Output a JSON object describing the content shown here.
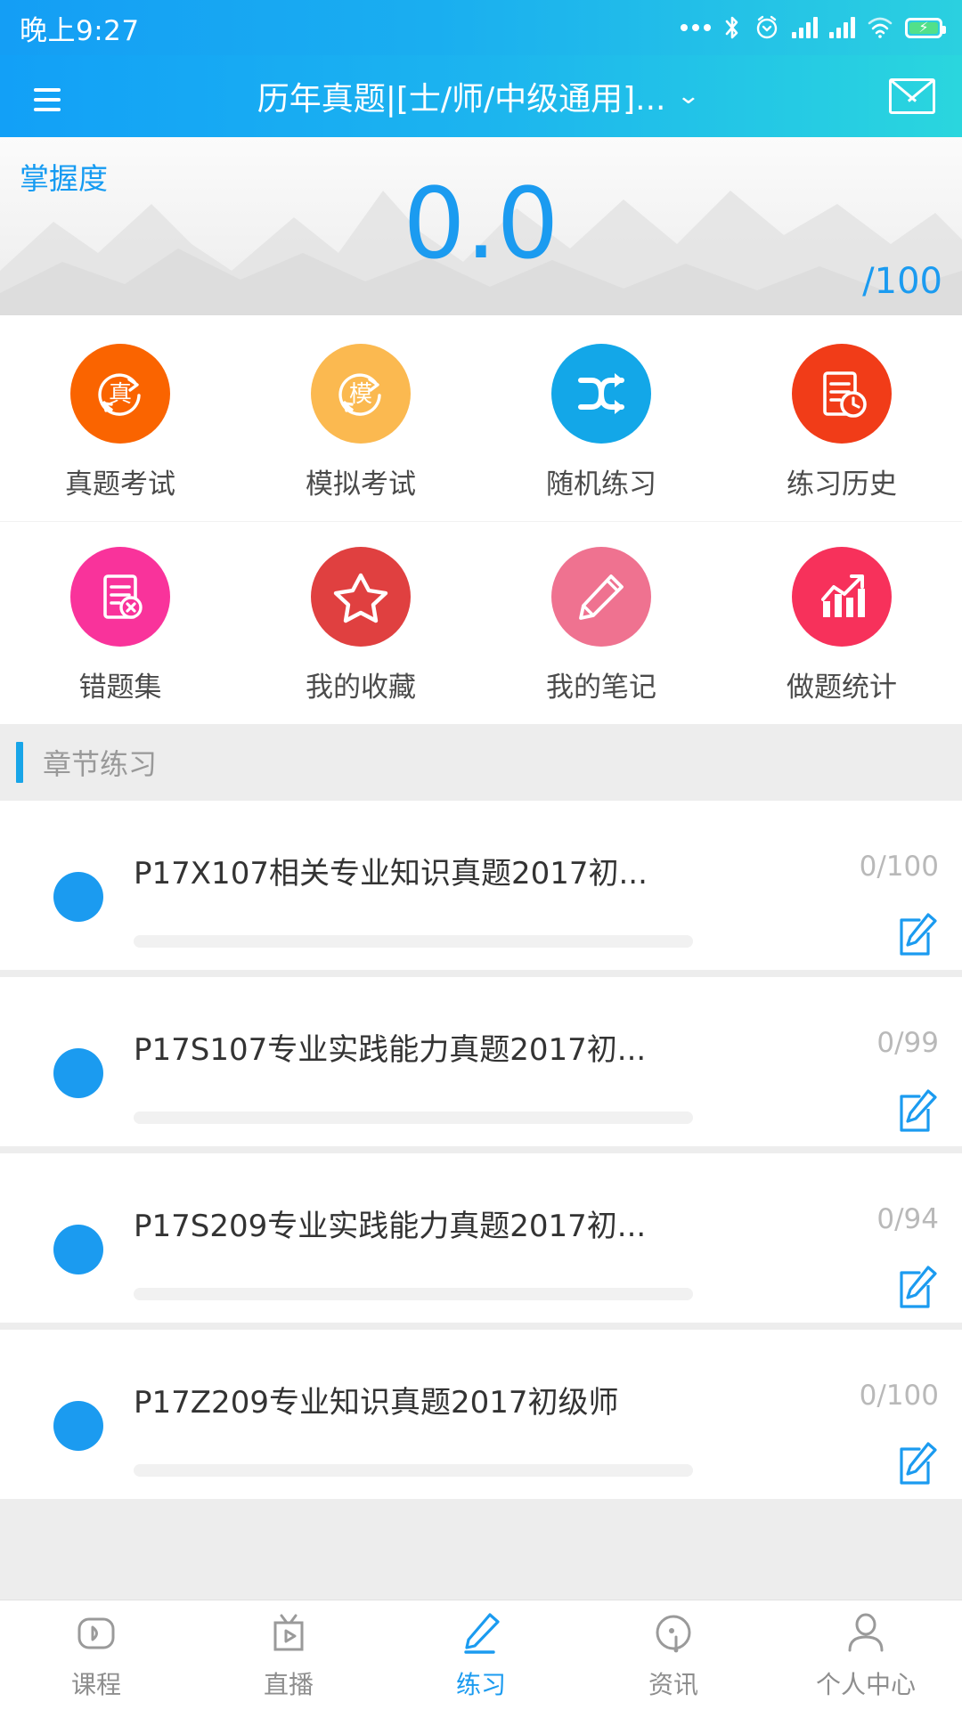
{
  "status_bar": {
    "time": "晚上9:27",
    "icons": [
      "more-dots-icon",
      "bluetooth-icon",
      "alarm-icon",
      "signal-icon",
      "signal-icon",
      "wifi-icon",
      "battery-charging-icon"
    ]
  },
  "app_bar": {
    "menu_icon": "hamburger-menu-icon",
    "title": "历年真题|[士/师/中级通用]...",
    "chevron": "⌄",
    "mail_icon": "mail-icon"
  },
  "banner": {
    "label": "掌握度",
    "score": "0.0",
    "max": "/100",
    "score_color": "#1b9bf0"
  },
  "grid": {
    "rows": [
      [
        {
          "label": "真题考试",
          "icon": "real-exam-icon",
          "color": "#fa6400"
        },
        {
          "label": "模拟考试",
          "icon": "mock-exam-icon",
          "color": "#fbb950"
        },
        {
          "label": "随机练习",
          "icon": "shuffle-icon",
          "color": "#13a7e8"
        },
        {
          "label": "练习历史",
          "icon": "history-record-icon",
          "color": "#f13c18"
        }
      ],
      [
        {
          "label": "错题集",
          "icon": "wrong-question-icon",
          "color": "#f9339b"
        },
        {
          "label": "我的收藏",
          "icon": "star-icon",
          "color": "#e04040"
        },
        {
          "label": "我的笔记",
          "icon": "pencil-note-icon",
          "color": "#ef7290"
        },
        {
          "label": "做题统计",
          "icon": "statistics-chart-icon",
          "color": "#f7315b"
        }
      ]
    ]
  },
  "section": {
    "title": "章节练习",
    "accent_color": "#18a5e8"
  },
  "list": {
    "items": [
      {
        "title": "P17X107相关专业知识真题2017初...",
        "count": "0/100",
        "edit_icon": "edit-icon"
      },
      {
        "title": "P17S107专业实践能力真题2017初...",
        "count": "0/99",
        "edit_icon": "edit-icon"
      },
      {
        "title": "P17S209专业实践能力真题2017初...",
        "count": "0/94",
        "edit_icon": "edit-icon"
      },
      {
        "title": "P17Z209专业知识真题2017初级师",
        "count": "0/100",
        "edit_icon": "edit-icon"
      }
    ]
  },
  "tab_bar": {
    "active_color": "#1b9bf0",
    "tabs": [
      {
        "label": "课程",
        "icon": "course-play-icon",
        "active": false
      },
      {
        "label": "直播",
        "icon": "live-tv-icon",
        "active": false
      },
      {
        "label": "练习",
        "icon": "practice-pencil-icon",
        "active": true
      },
      {
        "label": "资讯",
        "icon": "news-icon",
        "active": false
      },
      {
        "label": "个人中心",
        "icon": "user-profile-icon",
        "active": false
      }
    ]
  }
}
